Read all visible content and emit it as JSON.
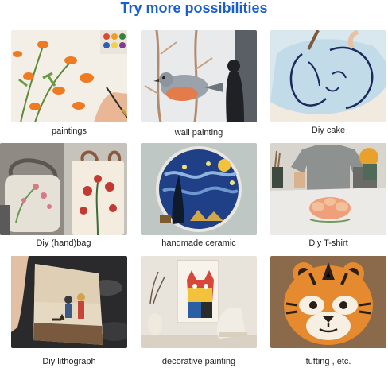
{
  "title": "Try more possibilities",
  "items": [
    {
      "caption": "paintings",
      "image": "orange-flowers-painting"
    },
    {
      "caption": "wall painting",
      "image": "bird-wall-mural"
    },
    {
      "caption": "Diy cake",
      "image": "couple-line-art-cake"
    },
    {
      "caption": "Diy (hand)bag",
      "image": "floral-painted-bags"
    },
    {
      "caption": "handmade ceramic",
      "image": "starry-night-ceramic-plate"
    },
    {
      "caption": "Diy T-shirt",
      "image": "flower-painted-tshirt"
    },
    {
      "caption": "Diy lithograph",
      "image": "couple-on-stone-painting"
    },
    {
      "caption": "decorative painting",
      "image": "abstract-cat-painting"
    },
    {
      "caption": "tufting , etc.",
      "image": "tiger-face-rug"
    }
  ]
}
